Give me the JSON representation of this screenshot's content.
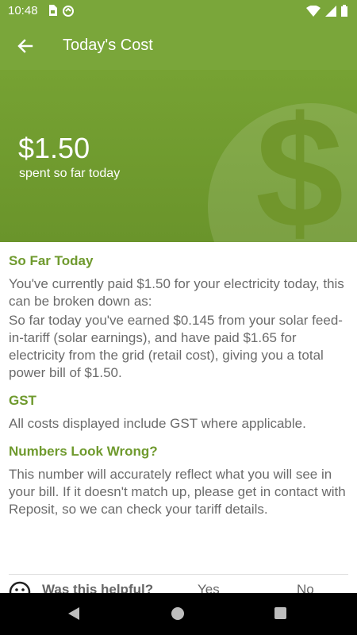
{
  "status_bar": {
    "time": "10:48"
  },
  "app_bar": {
    "title": "Today's Cost"
  },
  "hero": {
    "amount": "$1.50",
    "subtitle": "spent so far today"
  },
  "sections": [
    {
      "title": "So Far Today",
      "paragraphs": [
        "You've currently paid $1.50 for your electricity today, this can be broken down as:",
        "So far today you've earned $0.145 from your solar feed-in-tariff (solar earnings), and have paid $1.65 for electricity from the grid (retail cost), giving you a total power bill of $1.50."
      ]
    },
    {
      "title": "GST",
      "paragraphs": [
        "All costs displayed include GST where applicable."
      ]
    },
    {
      "title": "Numbers Look Wrong?",
      "paragraphs": [
        "This number will accurately reflect what you will see in your bill. If it doesn't match up, please get in contact with Reposit, so we can check your tariff details."
      ]
    }
  ],
  "feedback": {
    "question": "Was this helpful?",
    "yes_label": "Yes",
    "no_label": "No"
  },
  "colors": {
    "brand_green": "#7aa63a",
    "section_title_green": "#6f9a2e",
    "body_text": "#6b6b6b"
  },
  "icons": {
    "back": "arrow-left-icon",
    "sim": "sim-card-icon",
    "sync": "sync-icon",
    "wifi": "wifi-icon",
    "signal": "signal-icon",
    "battery": "battery-icon",
    "feedback_face": "neutral-face-icon"
  }
}
